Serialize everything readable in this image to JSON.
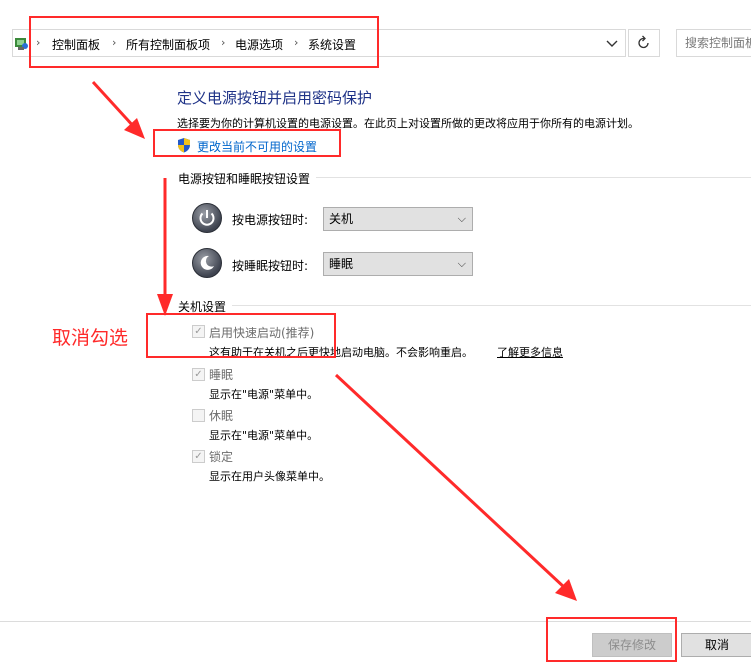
{
  "address_bar": {
    "breadcrumbs": [
      "控制面板",
      "所有控制面板项",
      "电源选项",
      "系统设置"
    ],
    "search_placeholder": "搜索控制面板"
  },
  "page": {
    "title": "定义电源按钮并启用密码保护",
    "description": "选择要为你的计算机设置的电源设置。在此页上对设置所做的更改将应用于你所有的电源计划。",
    "change_link": "更改当前不可用的设置"
  },
  "power_buttons": {
    "section_title": "电源按钮和睡眠按钮设置",
    "rows": [
      {
        "label": "按电源按钮时:",
        "value": "关机"
      },
      {
        "label": "按睡眠按钮时:",
        "value": "睡眠"
      }
    ]
  },
  "shutdown": {
    "section_title": "关机设置",
    "options": [
      {
        "label": "启用快速启动(推荐)",
        "desc": "这有助于在关机之后更快地启动电脑。不会影响重启。",
        "link": "了解更多信息",
        "checked": true
      },
      {
        "label": "睡眠",
        "desc": "显示在\"电源\"菜单中。",
        "checked": true
      },
      {
        "label": "休眠",
        "desc": "显示在\"电源\"菜单中。",
        "checked": false
      },
      {
        "label": "锁定",
        "desc": "显示在用户头像菜单中。",
        "checked": true
      }
    ]
  },
  "annotation": {
    "text": "取消勾选",
    "color": "#ff2a2a"
  },
  "footer": {
    "save_label": "保存修改",
    "cancel_label": "取消"
  },
  "colors": {
    "title": "#1e3287",
    "link": "#0066cc",
    "annotation": "#ff2a2a"
  }
}
